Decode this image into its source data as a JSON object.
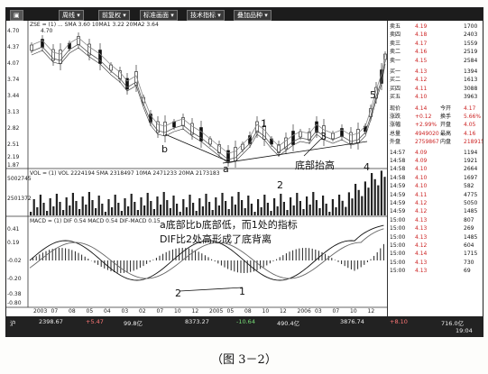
{
  "menu": [
    "周线 ▾",
    "前复权 ▾",
    "标准画面 ▾",
    "技术指标 ▾",
    "叠加品种 ▾"
  ],
  "price_axis": [
    "4.70",
    "4.37",
    "4.07",
    "3.74",
    "3.44",
    "3.13",
    "2.82",
    "2.51",
    "2.19",
    "1.87"
  ],
  "price_top_label": "4.70",
  "legend_price": "ZSE = (1) ... SMA 3.60 10MA1 3.22 20MA2 3.64",
  "volume_axis": [
    "5002745",
    "2501372"
  ],
  "legend_volume": "VOL = (1) VOL 2224194 5MA 2318497 10MA 2471233 20MA 2173183",
  "macd_axis": [
    "0.41",
    "0.19",
    "-0.02",
    "-0.20",
    "-0.38",
    "-0.80"
  ],
  "legend_macd": "MACD = (1) DIF 0.54 MACD 0.54 DIF-MACD 0.15",
  "date_axis": [
    "2003",
    "07",
    "08",
    "05",
    "04",
    "03",
    "02",
    "07",
    "10",
    "12",
    "2005",
    "05",
    "08",
    "10",
    "12",
    "2006",
    "03",
    "07",
    "10",
    "12"
  ],
  "annotations": {
    "wave_labels": [
      "a",
      "b",
      "1",
      "2",
      "3",
      "4",
      "5"
    ],
    "bottom_divergence": "底部抬高",
    "macd_note_line1": "a底部比b底部低，而1处的指标",
    "macd_note_line2": "DIF比2处高形成了底背离",
    "macd_points": [
      "1",
      "2"
    ]
  },
  "quote": {
    "asks": [
      {
        "name": "卖五",
        "price": "4.19",
        "vol": "1700"
      },
      {
        "name": "卖四",
        "price": "4.18",
        "vol": "2403"
      },
      {
        "name": "卖三",
        "price": "4.17",
        "vol": "1559"
      },
      {
        "name": "卖二",
        "price": "4.16",
        "vol": "2519"
      },
      {
        "name": "卖一",
        "price": "4.15",
        "vol": "2584"
      }
    ],
    "bids": [
      {
        "name": "买一",
        "price": "4.13",
        "vol": "1394"
      },
      {
        "name": "买二",
        "price": "4.12",
        "vol": "1613"
      },
      {
        "name": "买四",
        "price": "4.11",
        "vol": "3088"
      },
      {
        "name": "买五",
        "price": "4.10",
        "vol": "3963"
      }
    ],
    "stats": [
      {
        "a": "现价",
        "b": "4.14",
        "c": "今开",
        "d": "4.17"
      },
      {
        "a": "涨跌",
        "b": "+0.12",
        "c": "换手",
        "d": "5.66%"
      },
      {
        "a": "涨幅",
        "b": "+2.99%",
        "c": "开盘",
        "d": "4.05"
      },
      {
        "a": "总量",
        "b": "4949020",
        "c": "最高",
        "d": "4.16"
      },
      {
        "a": "外盘",
        "b": "2759867",
        "c": "内盘",
        "d": "2189153"
      }
    ],
    "ticks": [
      {
        "t": "14:57",
        "p": "4.09",
        "v": "1194"
      },
      {
        "t": "14:58",
        "p": "4.09",
        "v": "1921"
      },
      {
        "t": "14:58",
        "p": "4.10",
        "v": "2664"
      },
      {
        "t": "14:58",
        "p": "4.10",
        "v": "1697"
      },
      {
        "t": "14:59",
        "p": "4.10",
        "v": "582"
      },
      {
        "t": "14:59",
        "p": "4.11",
        "v": "4775"
      },
      {
        "t": "14:59",
        "p": "4.12",
        "v": "5050"
      },
      {
        "t": "14:59",
        "p": "4.12",
        "v": "1485"
      },
      {
        "t": "15:00",
        "p": "4.13",
        "v": "807"
      },
      {
        "t": "15:00",
        "p": "4.13",
        "v": "269"
      },
      {
        "t": "15:00",
        "p": "4.13",
        "v": "1485"
      },
      {
        "t": "15:00",
        "p": "4.12",
        "v": "604"
      },
      {
        "t": "15:00",
        "p": "4.14",
        "v": "1715"
      },
      {
        "t": "15:00",
        "p": "4.13",
        "v": "730"
      },
      {
        "t": "15:00",
        "p": "4.13",
        "v": "69"
      }
    ]
  },
  "status": [
    "沪",
    "2398.67",
    "+5.47",
    "99.8亿",
    "8373.27",
    "-10.64",
    "490.4亿",
    "3876.74",
    "+8.10",
    "716.0亿",
    "19:04"
  ],
  "caption": "（图 3－2）",
  "colors": {
    "up": "#c22",
    "down": "#2a7a2a",
    "frame": "#222"
  }
}
